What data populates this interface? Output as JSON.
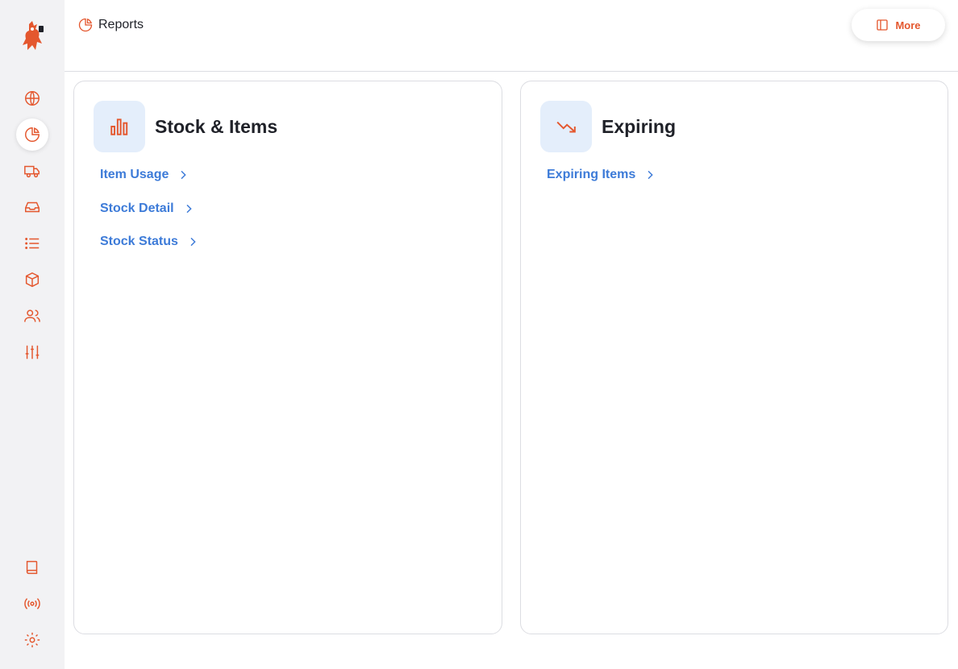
{
  "header": {
    "breadcrumb_icon": "pie-chart-icon",
    "title": "Reports",
    "more_label": "More"
  },
  "sidebar": {
    "items": [
      {
        "name": "globe",
        "icon": "globe-icon",
        "active": false
      },
      {
        "name": "reports",
        "icon": "pie-chart-icon",
        "active": true
      },
      {
        "name": "shipping",
        "icon": "truck-icon",
        "active": false
      },
      {
        "name": "inbox",
        "icon": "inbox-icon",
        "active": false
      },
      {
        "name": "list",
        "icon": "list-icon",
        "active": false
      },
      {
        "name": "inventory",
        "icon": "box-icon",
        "active": false
      },
      {
        "name": "users",
        "icon": "users-icon",
        "active": false
      },
      {
        "name": "settings-sliders",
        "icon": "sliders-icon",
        "active": false
      }
    ],
    "bottom_items": [
      {
        "name": "book",
        "icon": "book-icon"
      },
      {
        "name": "broadcast",
        "icon": "radio-signal-icon"
      },
      {
        "name": "settings",
        "icon": "gear-icon"
      }
    ]
  },
  "cards": [
    {
      "title": "Stock & Items",
      "icon": "bar-chart-icon",
      "links": [
        "Item Usage",
        "Stock Detail",
        "Stock Status"
      ]
    },
    {
      "title": "Expiring",
      "icon": "trending-down-icon",
      "links": [
        "Expiring Items"
      ]
    }
  ],
  "colors": {
    "accent": "#e4572e",
    "link": "#3d7bd8",
    "icon_bg": "#e4eefb",
    "sidebar_bg": "#f2f2f4"
  }
}
